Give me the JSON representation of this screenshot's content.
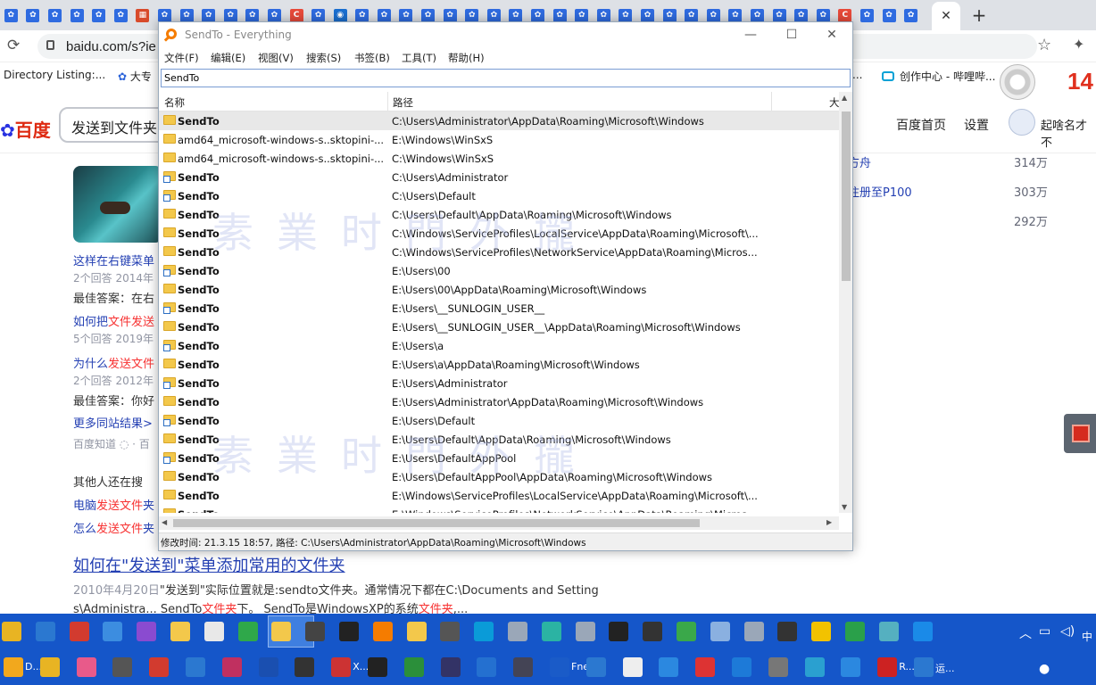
{
  "browser": {
    "tab_favicons": [
      "paw",
      "paw",
      "paw",
      "paw",
      "paw",
      "paw",
      "grid",
      "paw",
      "paw",
      "paw",
      "paw",
      "paw",
      "paw",
      "C",
      "paw",
      "circle",
      "paw",
      "paw",
      "paw",
      "paw",
      "paw",
      "paw",
      "paw",
      "paw",
      "paw",
      "paw",
      "paw",
      "paw",
      "paw",
      "paw",
      "paw",
      "paw",
      "paw",
      "paw",
      "paw",
      "paw",
      "paw",
      "paw",
      "C",
      "paw",
      "paw",
      "paw"
    ],
    "close_tab_icon": "✕",
    "new_tab_icon": "+",
    "url": "baidu.com/s?ie",
    "bookmarks": {
      "item1": "Directory Listing:...",
      "item2": "大专",
      "item3": "创作中心 - 哔哩哔...",
      "more": "..."
    },
    "red_number": "14"
  },
  "baidu": {
    "logo_text": "百度",
    "search_value": "发送到文件夹",
    "nav": {
      "home": "百度首页",
      "settings": "设置",
      "user": "起啥名才不"
    },
    "left_items": [
      {
        "text": "这样在右键菜单",
        "kind": "link"
      },
      {
        "text": "2个回答  2014年",
        "kind": "meta"
      },
      {
        "text": "最佳答案：在右",
        "kind": "plain"
      },
      {
        "text": "如何把文件发送",
        "kind": "link"
      },
      {
        "text": "5个回答  2019年",
        "kind": "meta"
      },
      {
        "text": "为什么发送文件",
        "kind": "link"
      },
      {
        "text": "2个回答  2012年",
        "kind": "meta"
      },
      {
        "text": "最佳答案：你好",
        "kind": "plain"
      },
      {
        "text": "更多同站结果>",
        "kind": "link"
      },
      {
        "text": "百度知道  ◌ · 百",
        "kind": "meta"
      },
      {
        "text": "其他人还在搜",
        "kind": "plain"
      },
      {
        "text": "电脑发送文件夹",
        "kind": "link"
      },
      {
        "text": "怎么发送文件夹",
        "kind": "link"
      }
    ],
    "hot": [
      {
        "title": "方舟",
        "count": "314万"
      },
      {
        "title": "注册至P100",
        "count": "303万"
      },
      {
        "title": "",
        "count": "292万"
      }
    ],
    "result_title": "如何在\"发送到\"菜单添加常用的文件夹",
    "result_date": "2010年4月20日",
    "result_snippet1": "\"发送到\"实际位置就是:sendto文件夹。通常情况下都在C:\\Documents and Setting",
    "result_snippet2": "s\\Administra... SendTo文件夹下。 SendTo是WindowsXP的系统文件夹,..."
  },
  "everything": {
    "title": "SendTo - Everything",
    "window_buttons": {
      "min": "—",
      "max": "☐",
      "close": "✕"
    },
    "menu": [
      "文件(F)",
      "编辑(E)",
      "视图(V)",
      "搜索(S)",
      "书签(B)",
      "工具(T)",
      "帮助(H)"
    ],
    "search_value": "SendTo",
    "columns": {
      "name": "名称",
      "path": "路径",
      "size": "大"
    },
    "rows": [
      {
        "name": "SendTo",
        "path": "C:\\Users\\Administrator\\AppData\\Roaming\\Microsoft\\Windows",
        "bold": true,
        "shortcut": false
      },
      {
        "name": "amd64_microsoft-windows-s..sktopini-...",
        "path": "E:\\Windows\\WinSxS",
        "bold": false,
        "shortcut": false
      },
      {
        "name": "amd64_microsoft-windows-s..sktopini-...",
        "path": "C:\\Windows\\WinSxS",
        "bold": false,
        "shortcut": false
      },
      {
        "name": "SendTo",
        "path": "C:\\Users\\Administrator",
        "bold": true,
        "shortcut": true
      },
      {
        "name": "SendTo",
        "path": "C:\\Users\\Default",
        "bold": true,
        "shortcut": true
      },
      {
        "name": "SendTo",
        "path": "C:\\Users\\Default\\AppData\\Roaming\\Microsoft\\Windows",
        "bold": true,
        "shortcut": false
      },
      {
        "name": "SendTo",
        "path": "C:\\Windows\\ServiceProfiles\\LocalService\\AppData\\Roaming\\Microsoft\\...",
        "bold": true,
        "shortcut": false
      },
      {
        "name": "SendTo",
        "path": "C:\\Windows\\ServiceProfiles\\NetworkService\\AppData\\Roaming\\Micros...",
        "bold": true,
        "shortcut": false
      },
      {
        "name": "SendTo",
        "path": "E:\\Users\\00",
        "bold": true,
        "shortcut": true
      },
      {
        "name": "SendTo",
        "path": "E:\\Users\\00\\AppData\\Roaming\\Microsoft\\Windows",
        "bold": true,
        "shortcut": false
      },
      {
        "name": "SendTo",
        "path": "E:\\Users\\__SUNLOGIN_USER__",
        "bold": true,
        "shortcut": true
      },
      {
        "name": "SendTo",
        "path": "E:\\Users\\__SUNLOGIN_USER__\\AppData\\Roaming\\Microsoft\\Windows",
        "bold": true,
        "shortcut": false
      },
      {
        "name": "SendTo",
        "path": "E:\\Users\\a",
        "bold": true,
        "shortcut": true
      },
      {
        "name": "SendTo",
        "path": "E:\\Users\\a\\AppData\\Roaming\\Microsoft\\Windows",
        "bold": true,
        "shortcut": false
      },
      {
        "name": "SendTo",
        "path": "E:\\Users\\Administrator",
        "bold": true,
        "shortcut": true
      },
      {
        "name": "SendTo",
        "path": "E:\\Users\\Administrator\\AppData\\Roaming\\Microsoft\\Windows",
        "bold": true,
        "shortcut": false
      },
      {
        "name": "SendTo",
        "path": "E:\\Users\\Default",
        "bold": true,
        "shortcut": true
      },
      {
        "name": "SendTo",
        "path": "E:\\Users\\Default\\AppData\\Roaming\\Microsoft\\Windows",
        "bold": true,
        "shortcut": false
      },
      {
        "name": "SendTo",
        "path": "E:\\Users\\DefaultAppPool",
        "bold": true,
        "shortcut": true
      },
      {
        "name": "SendTo",
        "path": "E:\\Users\\DefaultAppPool\\AppData\\Roaming\\Microsoft\\Windows",
        "bold": true,
        "shortcut": false
      },
      {
        "name": "SendTo",
        "path": "E:\\Windows\\ServiceProfiles\\LocalService\\AppData\\Roaming\\Microsoft\\...",
        "bold": true,
        "shortcut": false
      },
      {
        "name": "SendTo",
        "path": "E:\\Windows\\ServiceProfiles\\NetworkService\\AppData\\Roaming\\Micros...",
        "bold": true,
        "shortcut": false
      }
    ],
    "status": "修改时间: 21.3.15 18:57, 路径: C:\\Users\\Administrator\\AppData\\Roaming\\Microsoft\\Windows",
    "watermark": "素業时門外攏"
  },
  "taskbar": {
    "row1_icons": [
      {
        "name": "chrome",
        "color": "#e8b423"
      },
      {
        "name": "window",
        "color": "#2b78d0"
      },
      {
        "name": "app-red",
        "color": "#d23b2f"
      },
      {
        "name": "app-blue",
        "color": "#3c8de0"
      },
      {
        "name": "app-purple",
        "color": "#8a4bd0"
      },
      {
        "name": "folder",
        "color": "#f3c84b"
      },
      {
        "name": "document",
        "color": "#e8e8e8"
      },
      {
        "name": "record",
        "color": "#2fa84a"
      },
      {
        "name": "explorer",
        "color": "#f3c84b"
      },
      {
        "name": "monitor",
        "color": "#444"
      },
      {
        "name": "app-dot",
        "color": "#222"
      },
      {
        "name": "search",
        "color": "#f57c00"
      },
      {
        "name": "folder",
        "color": "#f3c84b"
      },
      {
        "name": "film",
        "color": "#555"
      },
      {
        "name": "app-teal",
        "color": "#0a9bd8"
      },
      {
        "name": "triangle",
        "color": "#9aa7b8"
      },
      {
        "name": "book",
        "color": "#2bb3a3"
      },
      {
        "name": "triangle",
        "color": "#9aa7b8"
      },
      {
        "name": "7z",
        "color": "#222"
      },
      {
        "name": "app-x",
        "color": "#333"
      },
      {
        "name": "globe",
        "color": "#3aa84a"
      },
      {
        "name": "app-r",
        "color": "#8ab0e0"
      },
      {
        "name": "triangle",
        "color": "#9aa7b8"
      },
      {
        "name": "clapper",
        "color": "#333"
      },
      {
        "name": "help",
        "color": "#f2c200"
      },
      {
        "name": "vb",
        "color": "#2aa04a"
      },
      {
        "name": "globe",
        "color": "#55b0c0"
      },
      {
        "name": "send",
        "color": "#1a8ae8"
      }
    ],
    "row2_items": [
      {
        "name": "app-d",
        "label": "D..."
      },
      {
        "name": "chrome",
        "label": ""
      },
      {
        "name": "app-pink",
        "label": ""
      },
      {
        "name": "app-bars",
        "label": ""
      },
      {
        "name": "app-red",
        "label": ""
      },
      {
        "name": "app-k",
        "label": ""
      },
      {
        "name": "app-game",
        "label": ""
      },
      {
        "name": "app-fb",
        "label": ""
      },
      {
        "name": "app-pe",
        "label": ""
      },
      {
        "name": "app-eye",
        "label": "X..."
      },
      {
        "name": "cmd",
        "label": ""
      },
      {
        "name": "app-grid",
        "label": ""
      },
      {
        "name": "app-exe",
        "label": ""
      },
      {
        "name": "app-kb",
        "label": ""
      },
      {
        "name": "app-pk",
        "label": ""
      },
      {
        "name": "app-fne",
        "label": "Fne"
      },
      {
        "name": "app-box",
        "label": ""
      },
      {
        "name": "document",
        "label": ""
      },
      {
        "name": "ie",
        "label": ""
      },
      {
        "name": "app-diamond",
        "label": ""
      },
      {
        "name": "app-win",
        "label": ""
      },
      {
        "name": "app-camera",
        "label": ""
      },
      {
        "name": "cloud",
        "label": ""
      },
      {
        "name": "ie",
        "label": ""
      },
      {
        "name": "bug",
        "label": "R..."
      },
      {
        "name": "run",
        "label": "运..."
      }
    ],
    "tray_char": "中"
  }
}
